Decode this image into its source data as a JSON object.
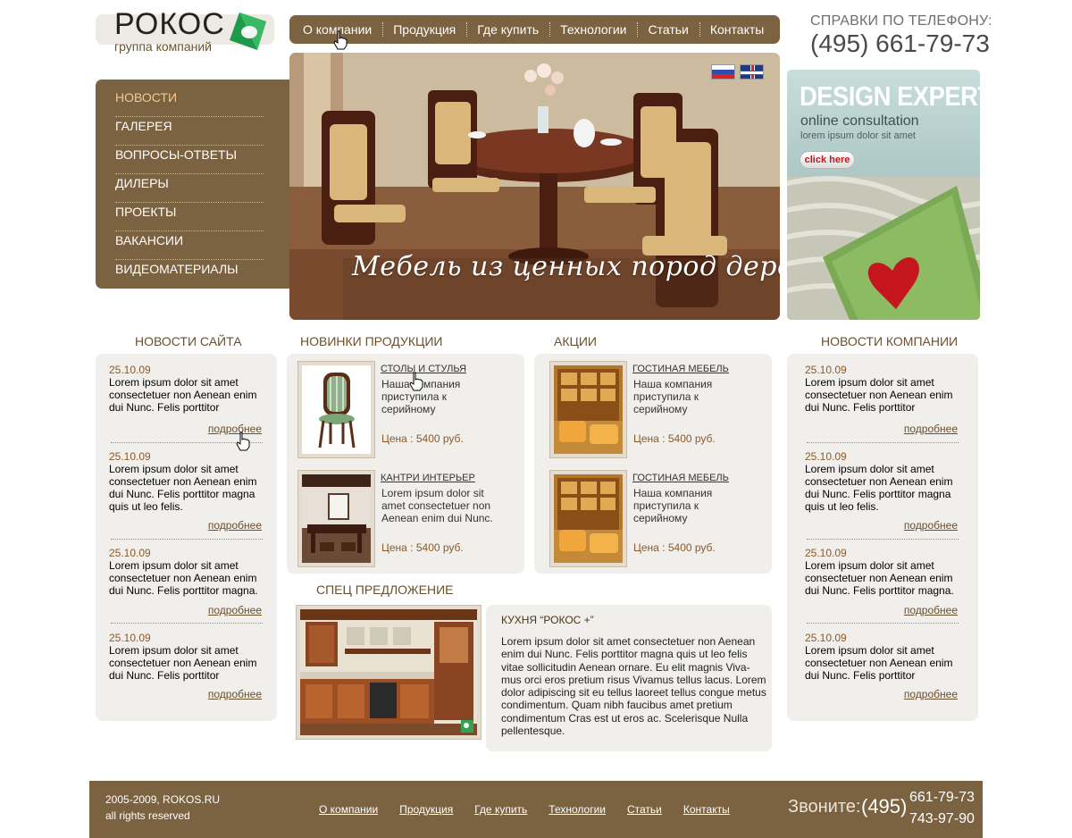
{
  "logo": {
    "name": "РОКОС",
    "subtitle": "группа компаний"
  },
  "topnav": [
    "О компании",
    "Продукция",
    "Где купить",
    "Технологии",
    "Статьи",
    "Контакты"
  ],
  "phone": {
    "label": "СПРАВКИ ПО ТЕЛЕФОНУ:",
    "number": "(495) 661-79-73"
  },
  "sidenav": [
    "НОВОСТИ",
    "ГАЛЕРЕЯ",
    "ВОПРОСЫ-ОТВЕТЫ",
    "ДИЛЕРЫ",
    "ПРОЕКТЫ",
    "ВАКАНСИИ",
    "ВИДЕОМАТЕРИАЛЫ"
  ],
  "hero": {
    "caption": "Мебель из ценных пород дерева"
  },
  "ad": {
    "title": "DESIGN EXPERT",
    "subtitle": "online consultation",
    "subtitle2": "lorem ipsum dolor sit amet",
    "button": "click here"
  },
  "site_news": {
    "title": "НОВОСТИ САЙТА",
    "items": [
      {
        "date": "25.10.09",
        "text": "Lorem ipsum dolor sit amet consectetuer non Aenean enim dui Nunc. Felis porttitor",
        "more": "подробнее"
      },
      {
        "date": "25.10.09",
        "text": "Lorem ipsum dolor sit amet consectetuer non Aenean enim dui Nunc. Felis porttitor magna quis ut leo felis.",
        "more": "подробнее"
      },
      {
        "date": "25.10.09",
        "text": "Lorem ipsum dolor sit amet consectetuer non Aenean enim dui Nunc. Felis porttitor magna.",
        "more": "подробнее"
      },
      {
        "date": "25.10.09",
        "text": "Lorem ipsum dolor sit amet consectetuer non Aenean enim dui Nunc. Felis porttitor",
        "more": "подробнее"
      }
    ]
  },
  "new_products": {
    "title": "НОВИНКИ ПРОДУКЦИИ",
    "items": [
      {
        "title": "СТОЛЫ И СТУЛЬЯ",
        "desc": "Наша компания приступила к серийному производству столов и",
        "price": "Цена : 5400 руб."
      },
      {
        "title": "КАНТРИ ИНТЕРЬЕР",
        "desc": "Lorem ipsum dolor sit amet consectetuer non Aenean enim dui Nunc.",
        "price": "Цена : 5400 руб."
      }
    ]
  },
  "promos": {
    "title": "АКЦИИ",
    "items": [
      {
        "title": "ГОСТИНАЯ МЕБЕЛЬ",
        "desc": "Наша компания приступила к серийному производству столов и",
        "price": "Цена : 5400 руб."
      },
      {
        "title": "ГОСТИНАЯ МЕБЕЛЬ",
        "desc": "Наша компания приступила к серийному производству столов и",
        "price": "Цена : 5400 руб."
      }
    ]
  },
  "company_news": {
    "title": "НОВОСТИ КОМПАНИИ",
    "items": [
      {
        "date": "25.10.09",
        "text": "Lorem ipsum dolor sit amet consectetuer non Aenean enim dui Nunc. Felis porttitor",
        "more": "подробнее"
      },
      {
        "date": "25.10.09",
        "text": "Lorem ipsum dolor sit amet consectetuer non Aenean enim dui Nunc. Felis porttitor magna quis ut leo felis.",
        "more": "подробнее"
      },
      {
        "date": "25.10.09",
        "text": "Lorem ipsum dolor sit amet consectetuer non Aenean enim dui Nunc. Felis porttitor magna.",
        "more": "подробнее"
      },
      {
        "date": "25.10.09",
        "text": "Lorem ipsum dolor sit amet consectetuer non Aenean enim dui Nunc. Felis porttitor",
        "more": "подробнее"
      }
    ]
  },
  "special": {
    "title": "СПЕЦ ПРЕДЛОЖЕНИЕ",
    "item_title": "КУХНЯ “РОКОС +”",
    "text": "Lorem ipsum dolor sit amet consectetuer non Aenean enim dui Nunc. Felis porttitor magna quis ut leo felis vitae sollicitudin Aenean ornare. Eu elit magnis Viva-mus orci eros pretium risus Vivamus tellus lacus. Lorem dolor adipiscing sit eu tellus laoreet tellus congue metus condimentum. Quam nibh faucibus amet pretium condimentum Cras est ut eros ac. Scelerisque Nulla pellentesque."
  },
  "footer": {
    "copyright": "2005-2009, ROKOS.RU",
    "rights": "all rights reserved",
    "links": [
      "О компании",
      "Продукция",
      "Где купить",
      "Технологии",
      "Статьи",
      "Контакты"
    ],
    "call_label": "Звоните:",
    "code": "(495)",
    "number1": "661-79-73",
    "number2": "743-97-90"
  },
  "colors": {
    "brand_brown": "#7b6240",
    "panel_bg": "#f1efeb",
    "accent_orange": "#f5c98a",
    "date_brown": "#8a5a2a"
  },
  "icons": [
    "logo-gem-icon",
    "flag-ru-icon",
    "flag-en-icon",
    "hand-cursor-icon"
  ]
}
